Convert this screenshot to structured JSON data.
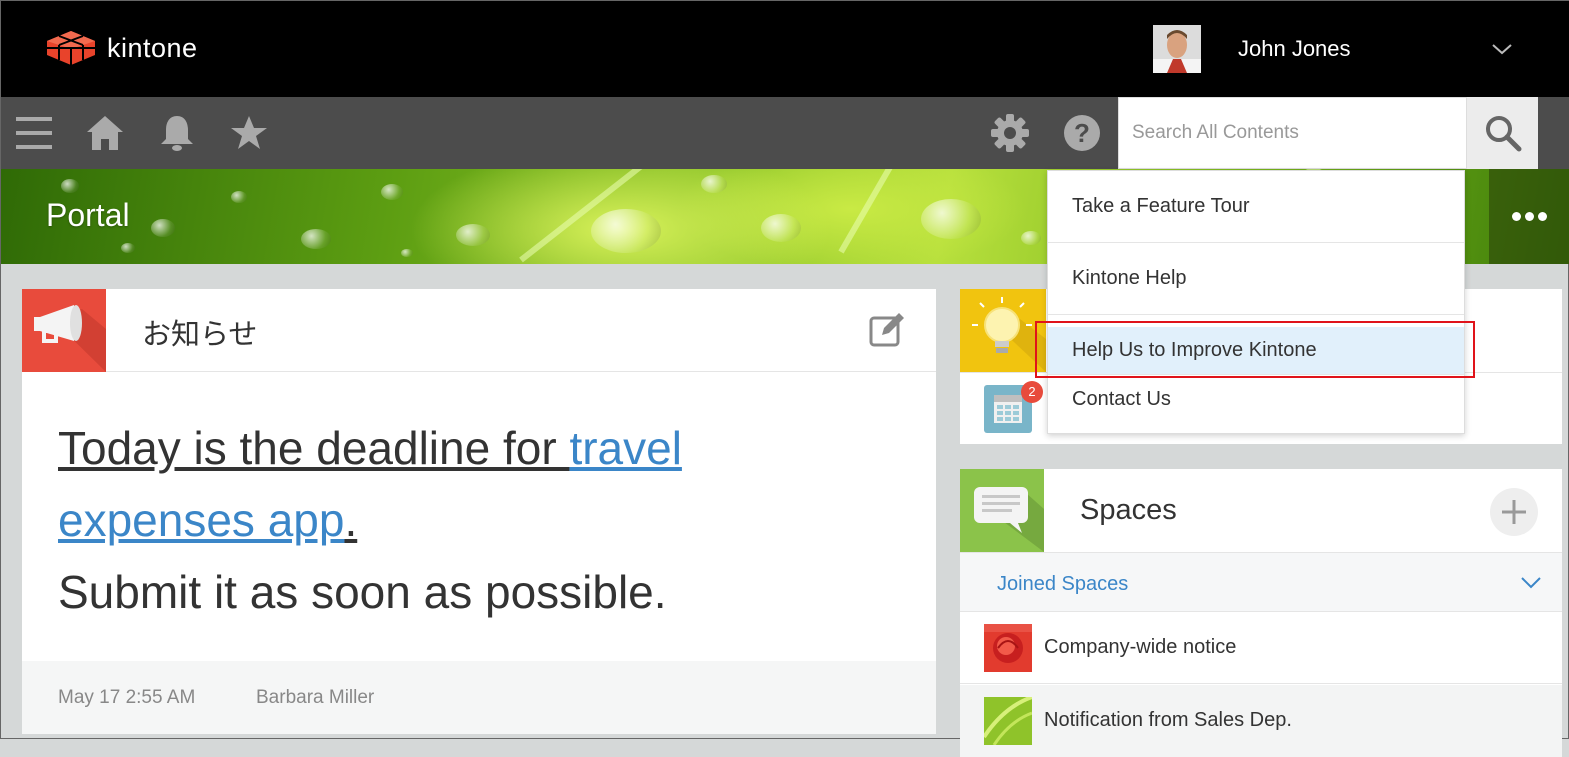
{
  "header": {
    "app_name": "kintone",
    "user_name": "John Jones"
  },
  "toolbar": {
    "menu_icon": "hamburger-icon",
    "home_icon": "home-icon",
    "notifications_icon": "bell-icon",
    "favorites_icon": "star-icon",
    "settings_icon": "gear-icon",
    "help_icon": "help-icon",
    "search_placeholder": "Search All Contents",
    "search_icon": "search-icon"
  },
  "banner": {
    "title": "Portal"
  },
  "help_menu": {
    "items": [
      {
        "label": "Take a Feature Tour"
      },
      {
        "label": "Kintone Help"
      },
      {
        "label": "Help Us to Improve Kintone"
      },
      {
        "label": "Contact Us"
      }
    ],
    "highlighted_index": 2,
    "highlight_color": "#e0131a"
  },
  "announcement": {
    "title": "お知らせ",
    "text_part1": "Today is the deadline for ",
    "link_text_1": "travel",
    "link_text_2": "expenses app",
    "text_part2": ".",
    "text_part3": "Submit it as soon as possible.",
    "date": "May 17 2:55 AM",
    "author": "Barbara Miller"
  },
  "apps_panel": {
    "badge_count": "2"
  },
  "spaces": {
    "title": "Spaces",
    "joined_label": "Joined Spaces",
    "items": [
      {
        "name": "Company-wide notice"
      },
      {
        "name": "Notification from Sales Dep."
      }
    ]
  },
  "colors": {
    "accent_link": "#3b86c8",
    "notice_icon_bg": "#e84b3c",
    "spaces_icon_bg": "#8bc34a",
    "idea_icon_bg": "#f1c40f",
    "highlight_bg": "#e1f0fb"
  }
}
